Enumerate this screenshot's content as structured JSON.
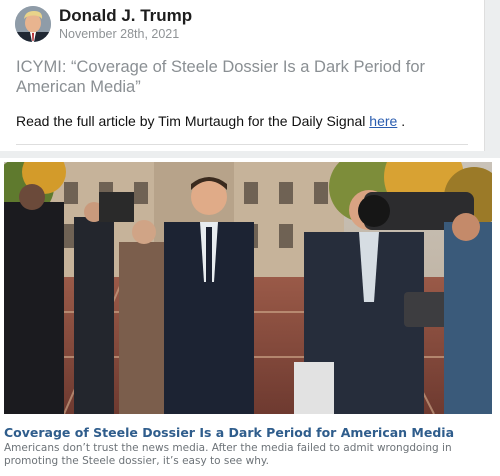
{
  "post": {
    "author": "Donald J. Trump",
    "date": "November 28th, 2021",
    "headline": "ICYMI: “Coverage of Steele Dossier Is a Dark Period for American Media”",
    "body_prefix": "Read the full article by Tim Murtaugh for the Daily Signal ",
    "link_text": "here",
    "body_suffix": " ."
  },
  "article": {
    "title": "Coverage of Steele Dossier Is a Dark Period for American Media",
    "description": "Americans don’t trust the news media. After the media failed to admit wrongdoing in promoting the Steele dossier, it’s easy to see why."
  },
  "colors": {
    "link": "#2a5db0",
    "article_title": "#2f5d8c",
    "muted": "#8a8f93"
  }
}
